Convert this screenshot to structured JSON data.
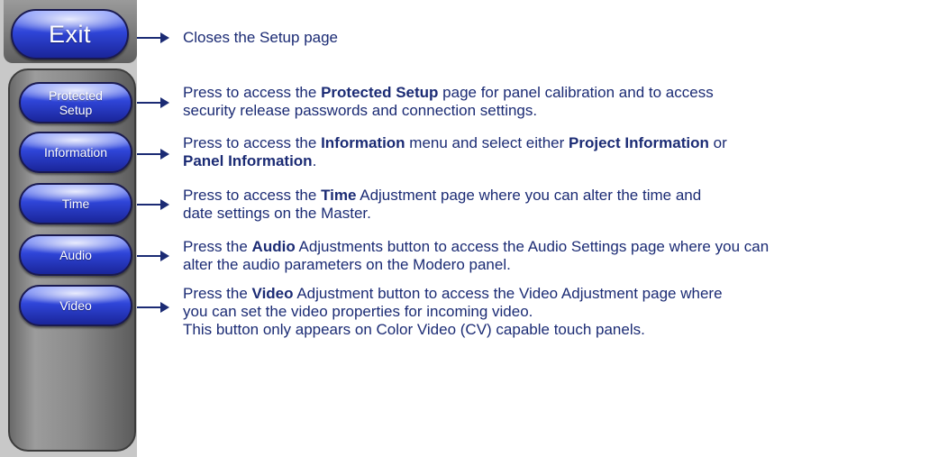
{
  "buttons": {
    "exit": "Exit",
    "protected_setup": "Protected\nSetup",
    "information": "Information",
    "time": "Time",
    "audio": "Audio",
    "video": "Video"
  },
  "descriptions": {
    "exit": {
      "t1": "Closes the Setup page"
    },
    "protected": {
      "t1": "Press to access the ",
      "b1": "Protected Setup",
      "t2": " page for panel calibration and to access",
      "t3": "security release passwords and connection settings."
    },
    "information": {
      "t1": "Press to access the ",
      "b1": "Information",
      "t2": " menu and select either ",
      "b2": "Project Information",
      "t3": " or",
      "b3": "Panel Information",
      "t4": "."
    },
    "time": {
      "t1": "Press to access the ",
      "b1": "Time",
      "t2": " Adjustment page where you can alter the time and",
      "t3": "date settings on the Master."
    },
    "audio": {
      "t1": "Press the ",
      "b1": "Audio",
      "t2": " Adjustments button to access the Audio Settings page where you can",
      "t3": "alter the audio parameters on the Modero panel."
    },
    "video": {
      "t1": "Press the ",
      "b1": "Video",
      "t2": " Adjustment button to access the Video Adjustment page where",
      "t3": "you can set the video properties for incoming video.",
      "t4": "This button only appears on Color Video (CV) capable touch panels."
    }
  },
  "colors": {
    "text": "#1b2b74",
    "button": "#2f45d8",
    "panel": "#c8c8c8"
  }
}
